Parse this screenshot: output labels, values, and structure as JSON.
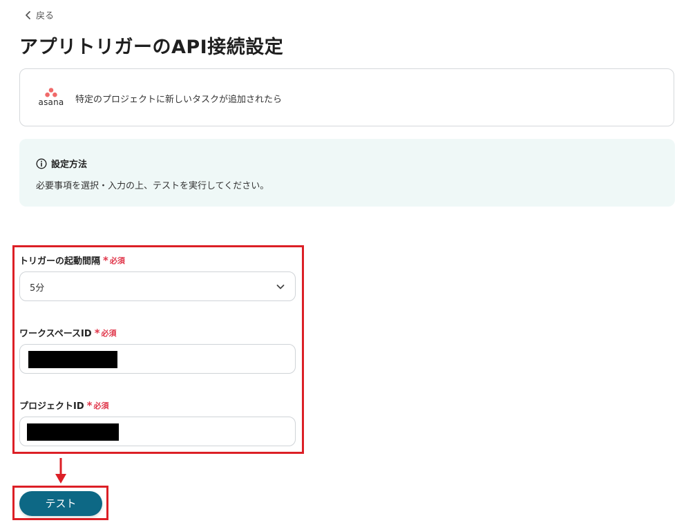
{
  "nav": {
    "back_label": "戻る"
  },
  "page": {
    "title": "アプリトリガーのAPI接続設定"
  },
  "app_card": {
    "app_name": "asana",
    "trigger_description": "特定のプロジェクトに新しいタスクが追加されたら"
  },
  "info": {
    "title": "設定方法",
    "body": "必要事項を選択・入力の上、テストを実行してください。"
  },
  "form": {
    "required_star": "*",
    "required_text": "必須",
    "fields": [
      {
        "label": "トリガーの起動間隔",
        "type": "select",
        "value": "5分"
      },
      {
        "label": "ワークスペースID",
        "type": "text",
        "value": ""
      },
      {
        "label": "プロジェクトID",
        "type": "text",
        "value": ""
      }
    ]
  },
  "actions": {
    "test_label": "テスト"
  },
  "colors": {
    "accent_red": "#dc1f26",
    "required_red": "#e0364a",
    "button_teal": "#0d6885",
    "info_bg": "#eff8f7"
  }
}
